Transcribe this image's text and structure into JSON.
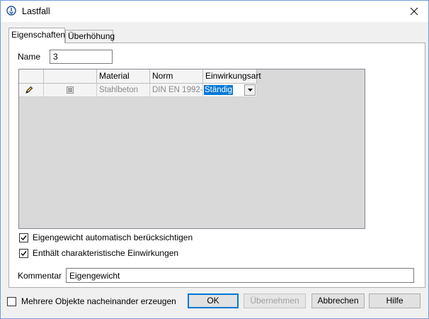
{
  "window": {
    "title": "Lastfall",
    "close_symbol": "✕"
  },
  "tabs": [
    {
      "label": "Eigenschaften",
      "active": true
    },
    {
      "label": "Überhöhung",
      "active": false
    }
  ],
  "name_field": {
    "label": "Name",
    "value": "3"
  },
  "grid": {
    "columns": [
      "",
      "",
      "Material",
      "Norm",
      "Einwirkungsart"
    ],
    "rows": [
      {
        "material": "Stahlbeton",
        "norm": "DIN EN 1992-",
        "einwirkungsart": "Ständig"
      }
    ]
  },
  "checkboxes": [
    {
      "label": "Eigengewicht automatisch berücksichtigen",
      "checked": true
    },
    {
      "label": "Enthält charakteristische Einwirkungen",
      "checked": true
    }
  ],
  "comment_field": {
    "label": "Kommentar",
    "value": "Eigengewicht"
  },
  "footer": {
    "multi_create_label": "Mehrere Objekte nacheinander erzeugen",
    "multi_create_checked": false,
    "ok_label": "OK",
    "apply_label": "Übernehmen",
    "cancel_label": "Abbrechen",
    "help_label": "Hilfe"
  }
}
